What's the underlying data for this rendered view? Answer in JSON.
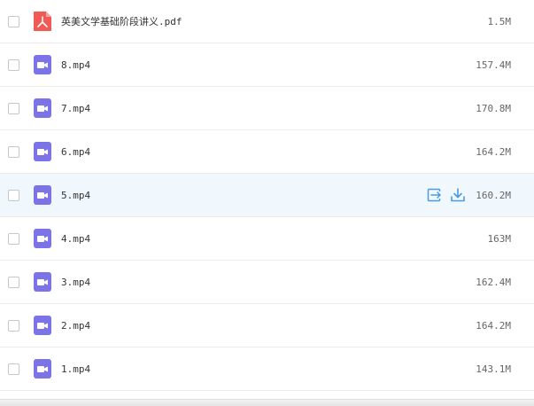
{
  "colors": {
    "pdf_icon": "#f25a55",
    "video_icon": "#7c74e6",
    "action_icon": "#4a9be0",
    "hover_row": "#f0f7fd"
  },
  "files": [
    {
      "name": "英美文学基础阶段讲义.pdf",
      "size": "1.5M",
      "icon": "pdf-icon"
    },
    {
      "name": "8.mp4",
      "size": "157.4M",
      "icon": "video-icon"
    },
    {
      "name": "7.mp4",
      "size": "170.8M",
      "icon": "video-icon"
    },
    {
      "name": "6.mp4",
      "size": "164.2M",
      "icon": "video-icon"
    },
    {
      "name": "5.mp4",
      "size": "160.2M",
      "icon": "video-icon"
    },
    {
      "name": "4.mp4",
      "size": "163M",
      "icon": "video-icon"
    },
    {
      "name": "3.mp4",
      "size": "162.4M",
      "icon": "video-icon"
    },
    {
      "name": "2.mp4",
      "size": "164.2M",
      "icon": "video-icon"
    },
    {
      "name": "1.mp4",
      "size": "143.1M",
      "icon": "video-icon"
    }
  ],
  "hover_actions": {
    "move_icon": "move-to-icon",
    "download_icon": "download-icon"
  }
}
